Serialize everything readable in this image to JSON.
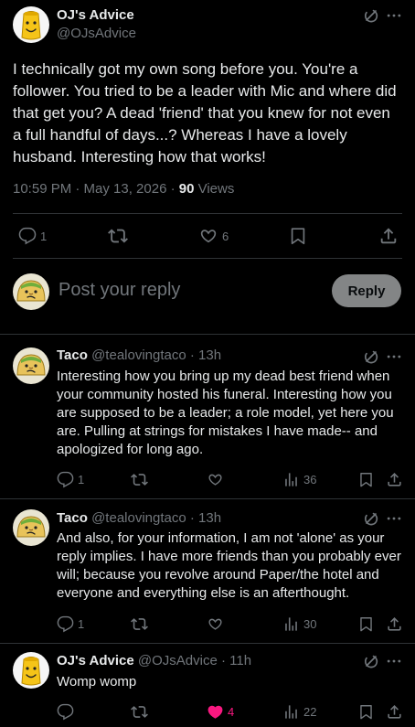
{
  "main_tweet": {
    "display_name": "OJ's Advice",
    "handle": "@OJsAdvice",
    "text": "I technically got my own song before you. You're a follower. You tried to be a leader with Mic and where did that get you? A dead 'friend' that you knew for not even a full handful of days...? Whereas I have a lovely husband. Interesting how that works!",
    "time": "10:59 PM · May 13, 2026 · ",
    "views_count": "90",
    "views_label": " Views",
    "replies": "1",
    "likes": "6"
  },
  "reply_box": {
    "placeholder": "Post your reply",
    "button_label": "Reply"
  },
  "replies": [
    {
      "display_name": "Taco",
      "handle_time": "@tealovingtaco · 13h",
      "text": "Interesting how you bring up my dead best friend when your community hosted his funeral. Interesting how you are supposed to be a leader; a role model, yet here you are. Pulling at strings for mistakes I have made-- and apologized for long ago.",
      "replies": "1",
      "views": "36"
    },
    {
      "display_name": "Taco",
      "handle_time": "@tealovingtaco · 13h",
      "text": "And also, for your information, I am not 'alone' as your reply implies. I have more friends than you probably ever will; because you revolve around Paper/the hotel and everyone and everything else is an afterthought.",
      "replies": "1",
      "views": "30"
    },
    {
      "display_name": "OJ's Advice",
      "handle_time": "@OJsAdvice · 11h",
      "text": "Womp womp",
      "likes": "4",
      "views": "22"
    }
  ],
  "colors": {
    "like_active": "#f91880",
    "reply_button_bg": "#eff3f4"
  }
}
